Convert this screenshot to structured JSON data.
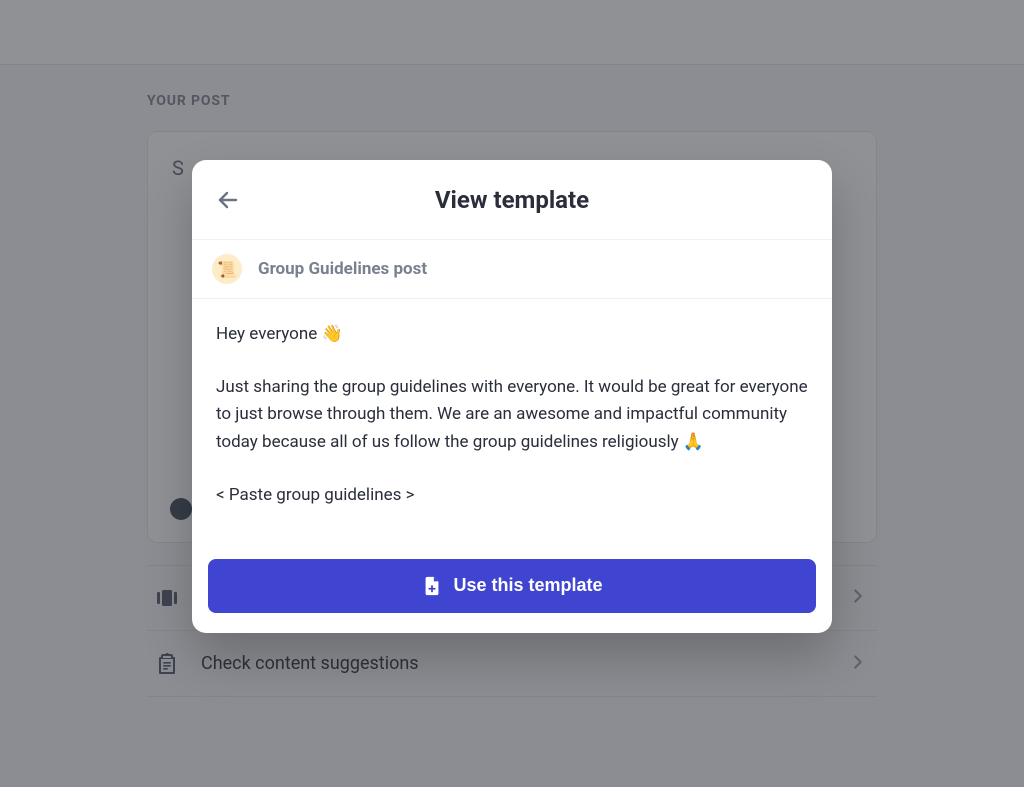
{
  "page": {
    "eyebrow": "YOUR POST",
    "post_hint_prefix": "S",
    "options": [
      {
        "label": "",
        "icon": "carousel"
      },
      {
        "label": "Check content suggestions",
        "icon": "clipboard"
      }
    ]
  },
  "modal": {
    "title": "View template",
    "template_name": "Group Guidelines post",
    "template_emoji": "📜",
    "body_line1": "Hey everyone 👋",
    "body_para": "Just sharing the group guidelines with everyone. It would be great for everyone to just browse through them. We are an awesome and impactful community today because all of us follow the group guidelines religiously 🙏",
    "body_placeholder": "< Paste group guidelines >",
    "cta_label": "Use this template"
  }
}
